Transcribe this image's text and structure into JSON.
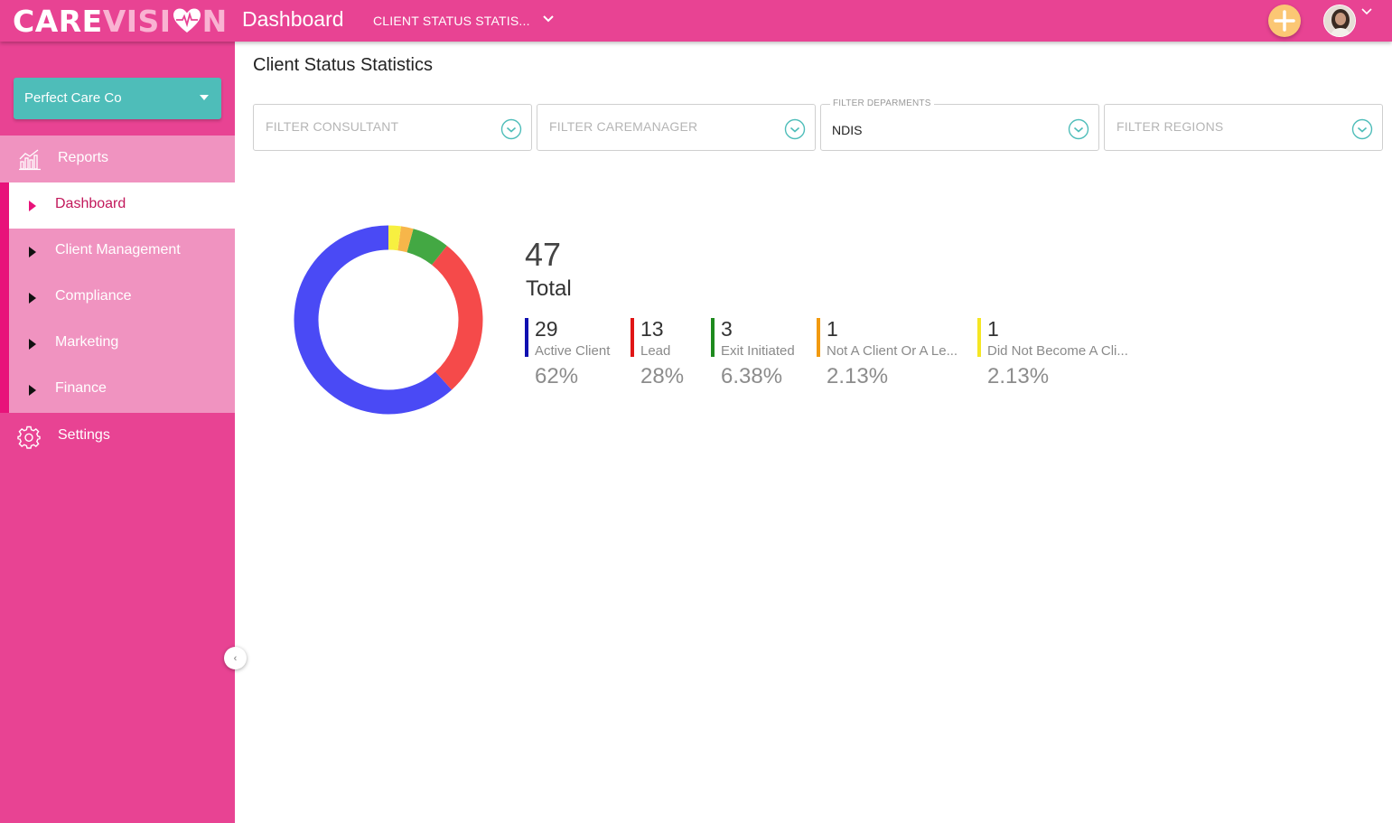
{
  "app": {
    "logo_care": "CARE",
    "logo_vision": "VISI",
    "logo_tail": "N",
    "title": "Dashboard",
    "report_selector": "CLIENT STATUS STATIS..."
  },
  "sidebar": {
    "org_select": "Perfect Care Co",
    "reports_label": "Reports",
    "items": [
      {
        "label": "Dashboard",
        "active": true
      },
      {
        "label": "Client Management",
        "active": false
      },
      {
        "label": "Compliance",
        "active": false
      },
      {
        "label": "Marketing",
        "active": false
      },
      {
        "label": "Finance",
        "active": false
      }
    ],
    "settings_label": "Settings",
    "collapse_symbol": "‹"
  },
  "main": {
    "page_title": "Client Status Statistics",
    "filters": [
      {
        "placeholder": "FILTER CONSULTANT",
        "value": ""
      },
      {
        "placeholder": "FILTER CAREMANAGER",
        "value": ""
      },
      {
        "legend": "FILTER DEPARMENTS",
        "value": "NDIS"
      },
      {
        "placeholder": "FILTER REGIONS",
        "value": ""
      }
    ]
  },
  "chart_data": {
    "type": "pie",
    "total": "47",
    "total_label": "Total",
    "series": [
      {
        "name": "Active Client",
        "value": 29,
        "percent": "62%",
        "color": "#4a4af5",
        "bar_color": "#1010b0"
      },
      {
        "name": "Lead",
        "value": 13,
        "percent": "28%",
        "color": "#f54a4a",
        "bar_color": "#e01515"
      },
      {
        "name": "Exit Initiated",
        "value": 3,
        "percent": "6.38%",
        "color": "#43a843",
        "bar_color": "#1e8a1e"
      },
      {
        "name": "Not A Client Or A Le...",
        "value": 1,
        "percent": "2.13%",
        "color": "#f7b64a",
        "bar_color": "#f29a0f"
      },
      {
        "name": "Did Not Become A Cli...",
        "value": 1,
        "percent": "2.13%",
        "color": "#f7f040",
        "bar_color": "#f5e623"
      }
    ]
  },
  "colors": {
    "brand_pink": "#e84393",
    "sidebar_light": "#f093c0",
    "teal": "#4ebdb9",
    "accent": "#e8127a"
  }
}
